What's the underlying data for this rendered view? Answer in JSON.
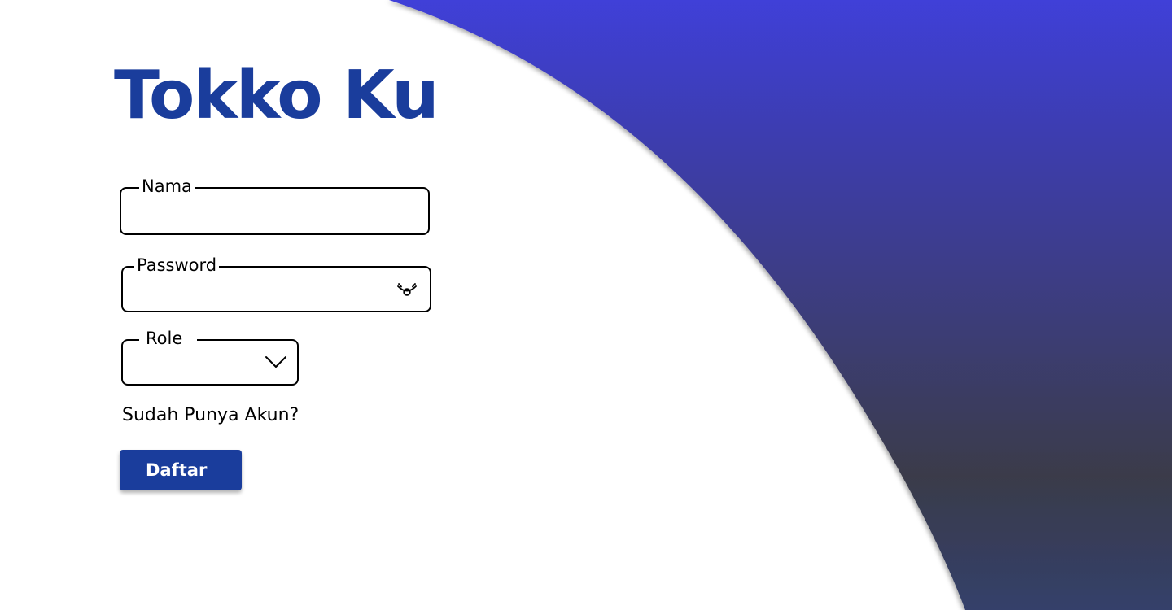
{
  "app": {
    "title": "Tokko Ku"
  },
  "form": {
    "nama": {
      "label": "Nama",
      "value": ""
    },
    "password": {
      "label": "Password",
      "value": "",
      "toggle_icon": "eye-icon"
    },
    "role": {
      "label": "Role",
      "selected": "",
      "dropdown_icon": "chevron-down-icon"
    },
    "login_prompt": "Sudah Punya Akun?",
    "submit_label": "Daftar"
  },
  "colors": {
    "brand": "#1a3d9c",
    "gradient_top": "#3f3fd8",
    "gradient_mid": "#3a3b4a",
    "gradient_bottom": "#34406a",
    "field_border": "#000000",
    "background": "#ffffff"
  }
}
